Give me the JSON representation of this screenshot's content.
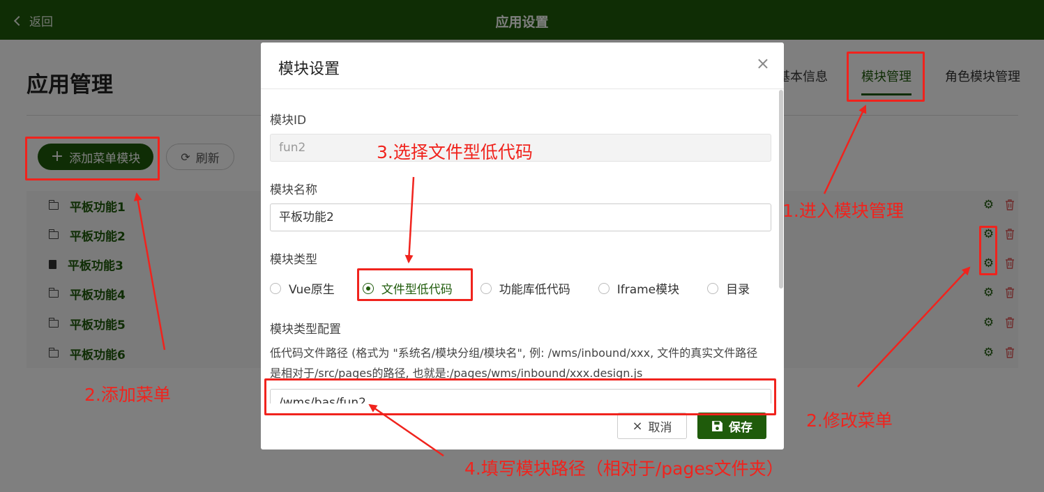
{
  "topbar": {
    "back_label": "返回",
    "title": "应用设置"
  },
  "page": {
    "title": "应用管理",
    "tabs": [
      {
        "label": "基本信息"
      },
      {
        "label": "模块管理",
        "active": true
      },
      {
        "label": "角色模块管理"
      }
    ],
    "add_button": "添加菜单模块",
    "refresh_button": "刷新",
    "modules": [
      {
        "label": "平板功能1",
        "icon": "folder-icon"
      },
      {
        "label": "平板功能2",
        "icon": "folder-icon"
      },
      {
        "label": "平板功能3",
        "icon": "document-icon"
      },
      {
        "label": "平板功能4",
        "icon": "folder-icon"
      },
      {
        "label": "平板功能5",
        "icon": "folder-icon"
      },
      {
        "label": "平板功能6",
        "icon": "folder-icon"
      }
    ]
  },
  "modal": {
    "title": "模块设置",
    "fields": {
      "id_label": "模块ID",
      "id_value": "fun2",
      "name_label": "模块名称",
      "name_value": "平板功能2",
      "type_label": "模块类型",
      "type_config_label": "模块类型配置",
      "path_value": "/wms/bas/fun2"
    },
    "types": [
      {
        "label": "Vue原生",
        "checked": false
      },
      {
        "label": "文件型低代码",
        "checked": true
      },
      {
        "label": "功能库低代码",
        "checked": false
      },
      {
        "label": "Iframe模块",
        "checked": false
      },
      {
        "label": "目录",
        "checked": false
      }
    ],
    "description": "低代码文件路径 (格式为 \"系统名/模块分组/模块名\", 例: /wms/inbound/xxx, 文件的真实文件路径是相对于/src/pages的路径, 也就是:/pages/wms/inbound/xxx.design.js",
    "cancel_label": "取消",
    "save_label": "保存"
  },
  "annotations": {
    "step1": "1.进入模块管理",
    "step2_add": "2.添加菜单",
    "step2_edit": "2.修改菜单",
    "step3": "3.选择文件型低代码",
    "step4": "4.填写模块路径（相对于/pages文件夹）"
  },
  "colors": {
    "brand": "#1f5b0b",
    "annotation": "#f0231d",
    "danger": "#e05a5a"
  }
}
